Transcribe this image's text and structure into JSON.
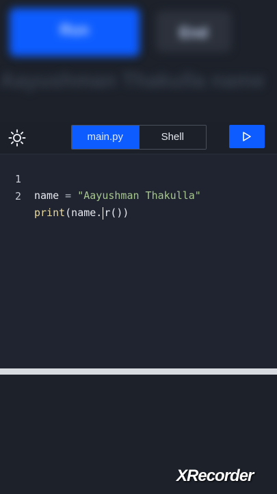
{
  "background": {
    "primary_button_label": "Run",
    "secondary_button_label": "End",
    "heading_text": "Aayushman Thakulla name"
  },
  "toolbar": {
    "tabs": [
      {
        "label": "main.py",
        "active": true
      },
      {
        "label": "Shell",
        "active": false
      }
    ],
    "theme_icon": "sun-icon",
    "run_icon": "play-icon"
  },
  "editor": {
    "lines": [
      {
        "number": "1",
        "tokens": [
          {
            "text": "name",
            "kind": "var"
          },
          {
            "text": " = ",
            "kind": "op"
          },
          {
            "text": "\"Aayushman Thakulla\"",
            "kind": "str"
          }
        ]
      },
      {
        "number": "2",
        "tokens": [
          {
            "text": "print",
            "kind": "fn"
          },
          {
            "text": "(name.",
            "kind": "var"
          },
          {
            "text": "r())",
            "kind": "var"
          }
        ]
      }
    ]
  },
  "colors": {
    "accent": "#0d5cff",
    "editor_bg": "#1f2430",
    "string": "#a8c78f",
    "function": "#e8d9a0"
  },
  "watermark": "XRecorder"
}
